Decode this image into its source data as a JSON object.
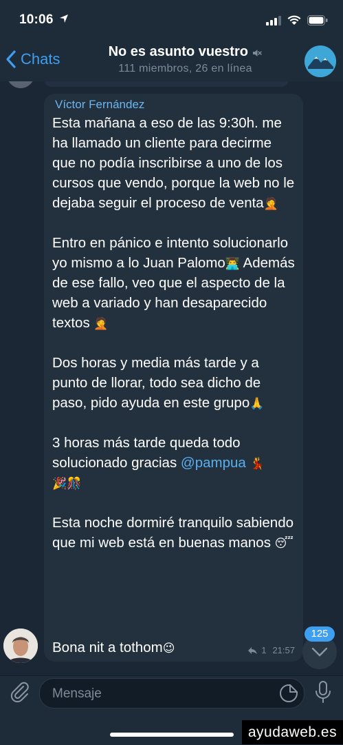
{
  "status_bar": {
    "time": "10:06"
  },
  "header": {
    "back_label": "Chats",
    "title": "No es asunto vuestro",
    "subtitle": "111 miembros, 26 en línea"
  },
  "message": {
    "sender": "Víctor Fernández",
    "p1": "Esta mañana a eso de las 9:30h. me ha llamado un cliente para decirme que no podía inscribirse a uno de los cursos que vendo, porque la web no le dejaba seguir el proceso de venta",
    "p2": "Entro en pánico e intento solucionarlo yo mismo a lo Juan Palomo",
    "p2b": " Además de ese fallo, veo que el aspecto de la web a variado y han desaparecido textos",
    "p3": "Dos horas y media más tarde y a punto de llorar, todo sea dicho de paso, pido ayuda en este grupo",
    "p4": "3 horas más tarde queda todo solucionado gracias ",
    "mention": "@pampua",
    "p5": "Esta noche dormiré tranquilo sabiendo que mi web está en buenas manos ",
    "p6": "Bona nit a tothom",
    "reply_count": "1",
    "time": "21:57"
  },
  "emojis": {
    "facepalm": "🤦",
    "technologist": "👨‍💻",
    "pray": "🙏",
    "dancer": "💃",
    "party": "🎉🎊",
    "sleeping": "😴",
    "wink": "😉"
  },
  "unread_count": "125",
  "input": {
    "placeholder": "Mensaje"
  },
  "watermark": "ayudaweb.es",
  "colors": {
    "accent": "#3e9ef0",
    "bubble": "#23313f",
    "background": "#1c2735",
    "sender_name": "#6cb6f0"
  }
}
